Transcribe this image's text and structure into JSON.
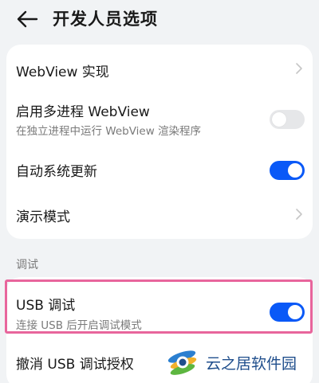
{
  "header": {
    "title": "开发人员选项"
  },
  "group1": {
    "webview_impl": {
      "title": "WebView 实现"
    },
    "multiprocess": {
      "title": "启用多进程 WebView",
      "subtitle": "在独立进程中运行 WebView 渲染程序",
      "enabled": false
    },
    "auto_update": {
      "title": "自动系统更新",
      "enabled": true
    },
    "demo_mode": {
      "title": "演示模式"
    }
  },
  "section_debug": {
    "label": "调试"
  },
  "group2": {
    "usb_debug": {
      "title": "USB 调试",
      "subtitle": "连接 USB 后开启调试模式",
      "enabled": true
    },
    "revoke": {
      "title": "撤消 USB 调试授权"
    }
  },
  "watermark": {
    "text": "云之居软件园"
  },
  "colors": {
    "accent": "#0a59f7",
    "highlight": "#e8659c",
    "background": "#f1f3f5"
  }
}
